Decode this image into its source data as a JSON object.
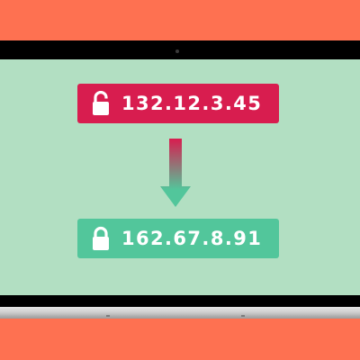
{
  "colors": {
    "background": "#fe7151",
    "bezel": "#000000",
    "screen": "#b2dfc2",
    "source_box": "#d81d4f",
    "target_box": "#52c69b",
    "text": "#ffffff"
  },
  "source": {
    "ip": "132.12.3.45",
    "icon": "unlocked-padlock-icon"
  },
  "target": {
    "ip": "162.67.8.91",
    "icon": "locked-padlock-icon"
  },
  "arrow": {
    "icon": "arrow-down-icon",
    "direction": "down"
  }
}
